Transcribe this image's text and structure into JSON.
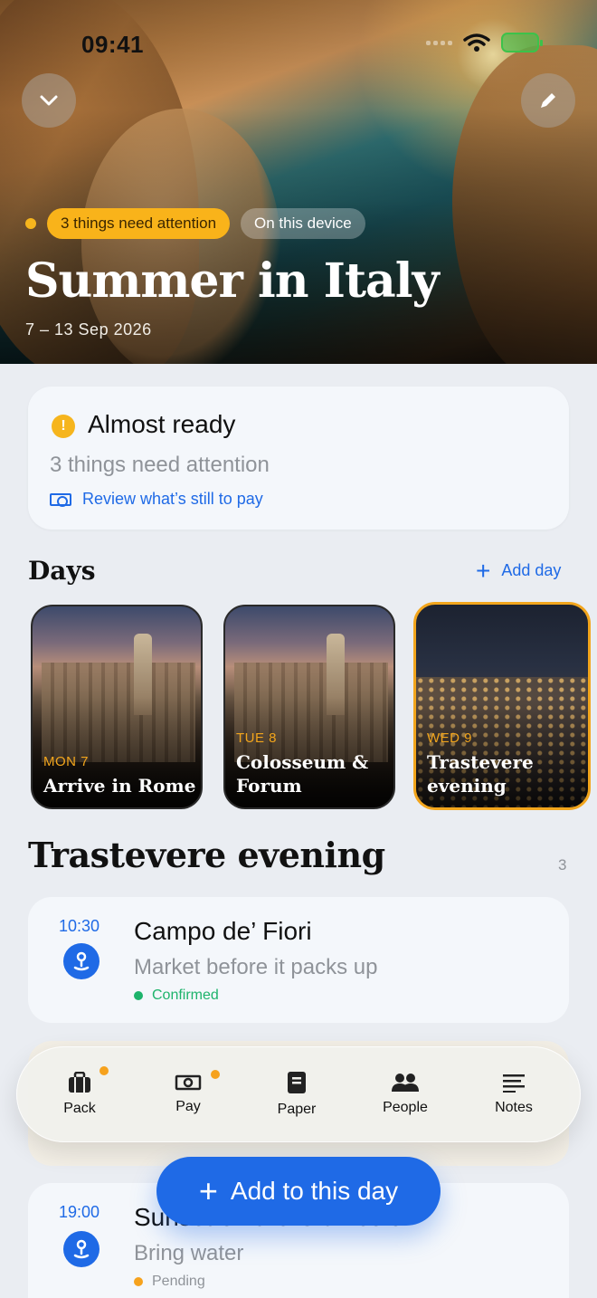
{
  "status_bar": {
    "time": "09:41"
  },
  "hero": {
    "attention_chip": "3 things need attention",
    "device_chip": "On this device",
    "title": "Summer in Italy",
    "dates": "7 – 13 Sep 2026"
  },
  "ready": {
    "title": "Almost ready",
    "subtitle": "3 things need attention",
    "link": "Review what’s still to pay"
  },
  "days": {
    "heading": "Days",
    "add_label": "Add day",
    "items": [
      {
        "label": "MON 7",
        "name": "Arrive in Rome",
        "selected": false
      },
      {
        "label": "TUE 8",
        "name": "Colosseum & Forum",
        "selected": false
      },
      {
        "label": "WED 9",
        "name": "Trastevere evening",
        "selected": true
      }
    ]
  },
  "section": {
    "title": "Trastevere evening",
    "count": "3"
  },
  "items": [
    {
      "time": "10:30",
      "title": "Campo de’ Fiori",
      "subtitle": "Market before it packs up",
      "status": "Confirmed",
      "status_color": "#1db36b"
    },
    {
      "time": "19:00",
      "title": "Sunset on the Gianicolo",
      "subtitle": "Bring water",
      "status": "Pending",
      "status_color": "#f6a21d"
    }
  ],
  "tabbar": {
    "tabs": [
      {
        "label": "Pack",
        "icon": "suitcase-icon",
        "badge": true
      },
      {
        "label": "Pay",
        "icon": "banknote-icon",
        "badge": true
      },
      {
        "label": "Paper",
        "icon": "document-icon",
        "badge": false
      },
      {
        "label": "People",
        "icon": "people-icon",
        "badge": false
      },
      {
        "label": "Notes",
        "icon": "notes-icon",
        "badge": false
      }
    ]
  },
  "fab": {
    "label": "Add to this day"
  },
  "colors": {
    "accent": "#1f6ae6",
    "warning": "#f6b51d",
    "success": "#1db36b",
    "selected_border": "#f2a51c"
  }
}
